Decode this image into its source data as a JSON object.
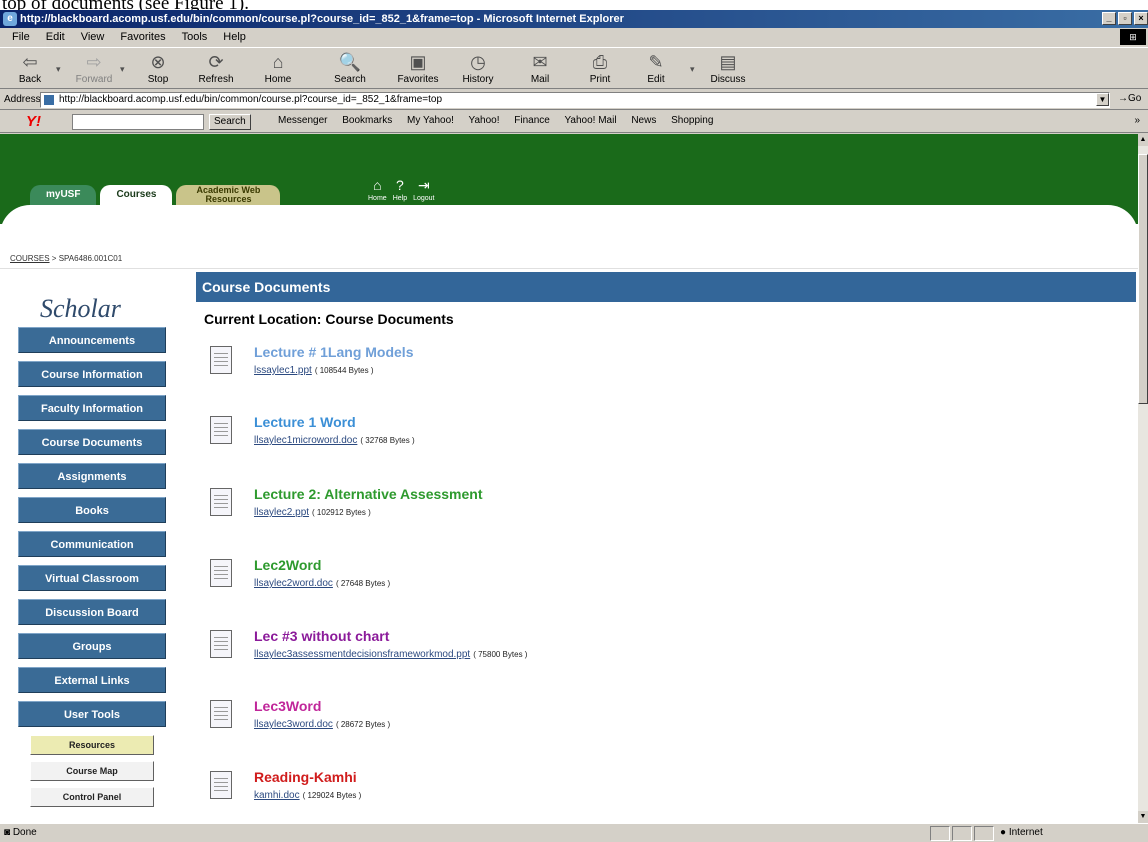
{
  "caption": "top of documents (see Figure 1).",
  "browser": {
    "title": "http://blackboard.acomp.usf.edu/bin/common/course.pl?course_id=_852_1&frame=top - Microsoft Internet Explorer",
    "winbtns": [
      "_",
      "▫",
      "×"
    ],
    "menu": [
      "File",
      "Edit",
      "View",
      "Favorites",
      "Tools",
      "Help"
    ],
    "toolbar": [
      {
        "label": "Back",
        "icon": "⇦"
      },
      {
        "label": "Forward",
        "icon": "⇨"
      },
      {
        "label": "Stop",
        "icon": "⊗"
      },
      {
        "label": "Refresh",
        "icon": "⟳"
      },
      {
        "label": "Home",
        "icon": "⌂"
      },
      {
        "label": "Search",
        "icon": "🔍"
      },
      {
        "label": "Favorites",
        "icon": "▣"
      },
      {
        "label": "History",
        "icon": "◷"
      },
      {
        "label": "Mail",
        "icon": "✉"
      },
      {
        "label": "Print",
        "icon": "⎙"
      },
      {
        "label": "Edit",
        "icon": "✎"
      },
      {
        "label": "Discuss",
        "icon": "▤"
      }
    ],
    "address_label": "Address",
    "address": "http://blackboard.acomp.usf.edu/bin/common/course.pl?course_id=_852_1&frame=top",
    "go_label": "Go",
    "yahoo": {
      "search_label": "Search",
      "links": [
        "Messenger",
        "Bookmarks",
        "My Yahoo!",
        "Yahoo!",
        "Finance",
        "Yahoo! Mail",
        "News",
        "Shopping"
      ],
      "more": "»"
    },
    "status_text": "Done",
    "zone_text": "Internet"
  },
  "bb": {
    "tabs": [
      "myUSF",
      "Courses",
      "Academic Web Resources"
    ],
    "header_icons": [
      {
        "icon": "⌂",
        "label": "Home"
      },
      {
        "icon": "?",
        "label": "Help"
      },
      {
        "icon": "⇥",
        "label": "Logout"
      }
    ],
    "breadcrumb_root": "COURSES",
    "breadcrumb_current": "SPA6486.001C01",
    "logo": "Scholar",
    "nav": [
      "Announcements",
      "Course Information",
      "Faculty Information",
      "Course Documents",
      "Assignments",
      "Books",
      "Communication",
      "Virtual Classroom",
      "Discussion Board",
      "Groups",
      "External Links",
      "User Tools"
    ],
    "tools": [
      "Resources",
      "Course Map",
      "Control Panel"
    ],
    "section_title": "Course Documents",
    "current_location": "Current Location: Course Documents",
    "documents": [
      {
        "title": "Lecture # 1Lang Models",
        "file": "lssaylec1.ppt",
        "size": "( 108544 Bytes )",
        "color": "#6f9fd8"
      },
      {
        "title": "Lecture 1 Word",
        "file": "llsaylec1microword.doc",
        "size": "( 32768 Bytes )",
        "color": "#3b8fd6"
      },
      {
        "title": "Lecture 2: Alternative Assessment",
        "file": "llsaylec2.ppt",
        "size": "( 102912 Bytes )",
        "color": "#2e9a2e"
      },
      {
        "title": "Lec2Word",
        "file": "llsaylec2word.doc",
        "size": "( 27648 Bytes )",
        "color": "#2e9a2e"
      },
      {
        "title": "Lec #3 without chart",
        "file": "llsaylec3assessmentdecisionsframeworkmod.ppt",
        "size": "( 75800 Bytes )",
        "color": "#8b1a9a"
      },
      {
        "title": "Lec3Word",
        "file": "llsaylec3word.doc",
        "size": "( 28672 Bytes )",
        "color": "#c0269a"
      },
      {
        "title": "Reading-Kamhi",
        "file": "kamhi.doc",
        "size": "( 129024 Bytes )",
        "color": "#d01c1c"
      }
    ]
  }
}
